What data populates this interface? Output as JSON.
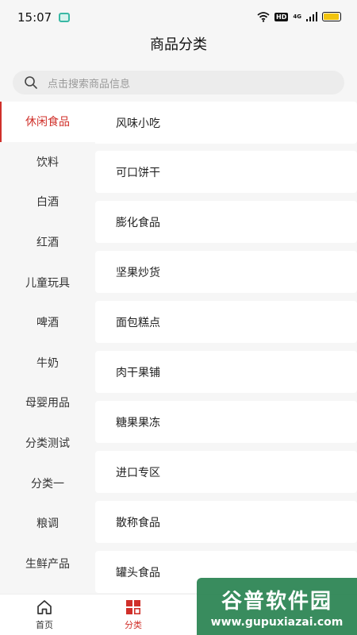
{
  "status_bar": {
    "time": "15:07",
    "hd": "HD",
    "network": "4G"
  },
  "header": {
    "title": "商品分类"
  },
  "search": {
    "placeholder": "点击搜索商品信息"
  },
  "sidebar": {
    "active_index": 0,
    "items": [
      "休闲食品",
      "饮料",
      "白酒",
      "红酒",
      "儿童玩具",
      "啤酒",
      "牛奶",
      "母婴用品",
      "分类测试",
      "分类一",
      "粮调",
      "生鲜产品"
    ]
  },
  "categories": [
    "风味小吃",
    "可口饼干",
    "膨化食品",
    "坚果炒货",
    "面包糕点",
    "肉干果铺",
    "糖果果冻",
    "进口专区",
    "散称食品",
    "罐头食品"
  ],
  "tabbar": {
    "tabs": [
      {
        "label": "首页",
        "icon": "home-icon"
      },
      {
        "label": "分类",
        "icon": "category-icon",
        "active": true
      }
    ]
  },
  "watermark": {
    "title": "谷普软件园",
    "url": "www.gupuxiazai.com"
  },
  "colors": {
    "accent": "#d0302a",
    "background": "#f6f6f6"
  }
}
